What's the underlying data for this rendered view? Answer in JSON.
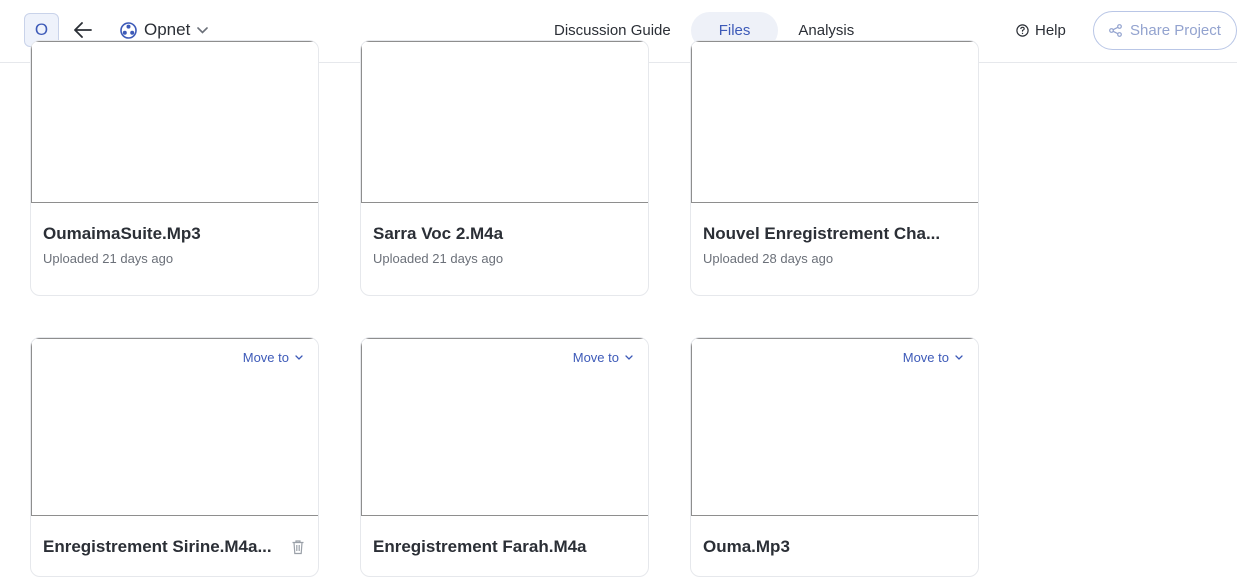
{
  "header": {
    "logo_letter": "O",
    "project_name": "Opnet",
    "tabs": [
      {
        "label": "Discussion Guide",
        "active": false
      },
      {
        "label": "Files",
        "active": true
      },
      {
        "label": "Analysis",
        "active": false
      }
    ],
    "help_label": "Help",
    "share_label": "Share Project"
  },
  "files": {
    "move_to_label": "Move to",
    "row1": [
      {
        "name": "OumaimaSuite.Mp3",
        "uploaded": "Uploaded 21 days ago"
      },
      {
        "name": "Sarra Voc 2.M4a",
        "uploaded": "Uploaded 21 days ago"
      },
      {
        "name": "Nouvel Enregistrement Cha...",
        "uploaded": "Uploaded 28 days ago"
      }
    ],
    "row2": [
      {
        "name": "Enregistrement Sirine.M4a..."
      },
      {
        "name": "Enregistrement Farah.M4a"
      },
      {
        "name": "Ouma.Mp3"
      }
    ]
  },
  "colors": {
    "accent": "#3d5ab8",
    "active_tab_bg": "#eef1f8",
    "border": "#e6e8ec"
  }
}
